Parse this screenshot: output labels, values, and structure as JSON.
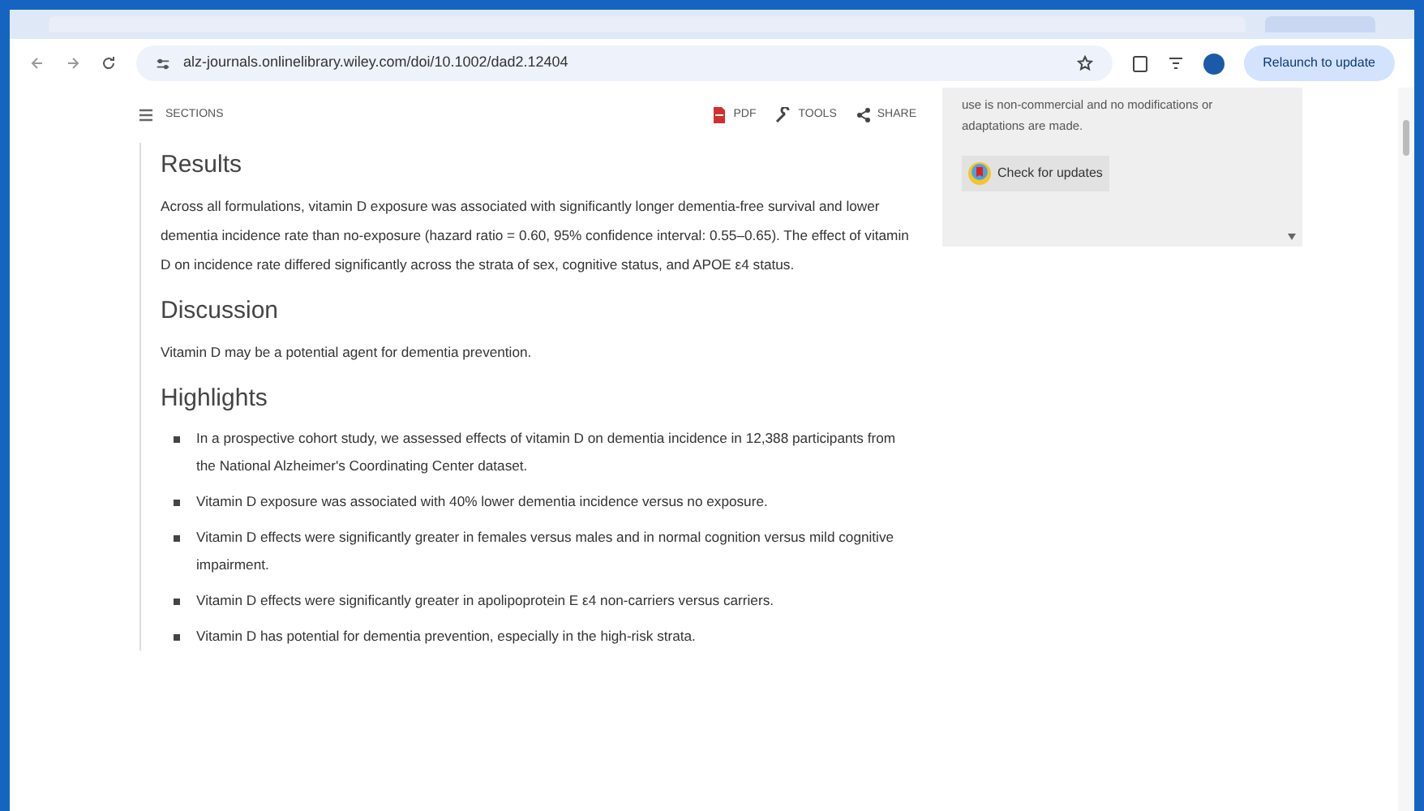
{
  "browser": {
    "url": "alz-journals.onlinelibrary.wiley.com/doi/10.1002/dad2.12404",
    "update_button": "Relaunch to update"
  },
  "toolbar": {
    "sections": "SECTIONS",
    "actions": [
      {
        "kind": "pdf",
        "label": "PDF"
      },
      {
        "kind": "tools",
        "label": "TOOLS"
      },
      {
        "kind": "share",
        "label": "SHARE"
      }
    ]
  },
  "side_panel": {
    "lines": [
      "use is non-commercial and no modifications or",
      "adaptations are made."
    ],
    "button": "Check for updates"
  },
  "article": [
    {
      "kind": "heading",
      "text": "Results"
    },
    {
      "kind": "paragraph",
      "text": "Across all formulations, vitamin D exposure was associated with significantly longer dementia-free survival and lower dementia incidence rate than no-exposure (hazard ratio = 0.60, 95% confidence interval: 0.55–0.65). The effect of vitamin D on incidence rate differed significantly across the strata of sex, cognitive status, and APOE ε4 status."
    },
    {
      "kind": "heading",
      "text": "Discussion"
    },
    {
      "kind": "paragraph",
      "text": "Vitamin D may be a potential agent for dementia prevention."
    },
    {
      "kind": "heading",
      "text": "Highlights"
    },
    {
      "kind": "bullets",
      "items": [
        "In a prospective cohort study, we assessed effects of vitamin D on dementia incidence in 12,388 participants from the National Alzheimer's Coordinating Center dataset.",
        "Vitamin D exposure was associated with 40% lower dementia incidence versus no exposure.",
        "Vitamin D effects were significantly greater in females versus males and in normal cognition versus mild cognitive impairment.",
        "Vitamin D effects were significantly greater in apolipoprotein E ε4 non-carriers versus carriers.",
        "Vitamin D has potential for dementia prevention, especially in the high-risk strata."
      ]
    }
  ]
}
